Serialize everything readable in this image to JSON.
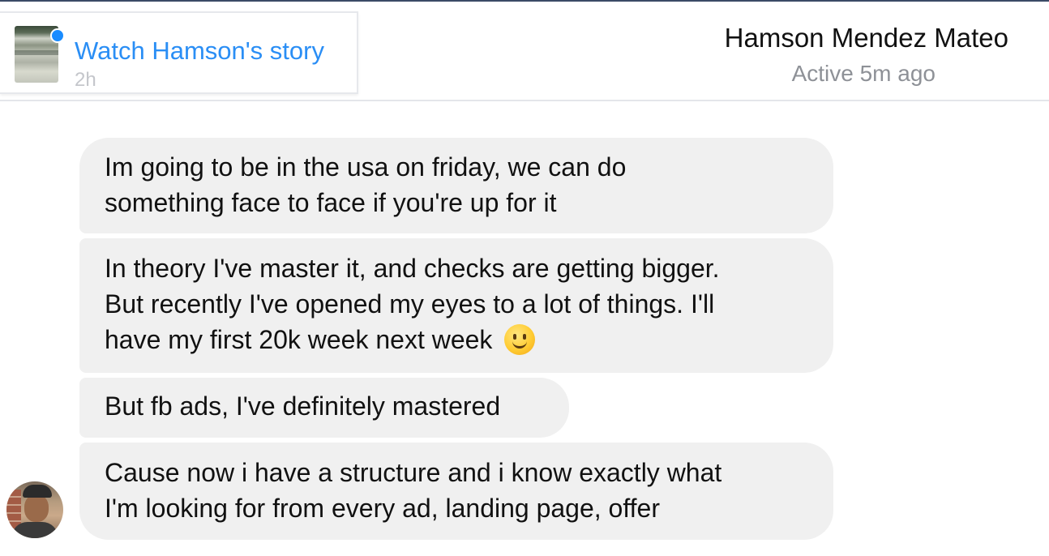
{
  "story": {
    "title": "Watch Hamson's story",
    "time": "2h"
  },
  "contact": {
    "name": "Hamson Mendez Mateo",
    "status": "Active 5m ago"
  },
  "messages": [
    {
      "lines": [
        "Im going to be in the usa on friday, we can do",
        "something face to face if you're up for it"
      ]
    },
    {
      "lines": [
        "In theory I've master it, and checks are getting bigger.",
        "But recently I've opened my eyes to a lot of things. I'll",
        "have my first 20k week next week"
      ],
      "emoji": "smiling-face"
    },
    {
      "lines": [
        "But fb ads, I've definitely mastered"
      ]
    },
    {
      "lines": [
        "Cause now i have a structure and i know exactly what",
        "I'm looking for from every ad, landing page, offer"
      ]
    }
  ],
  "colors": {
    "link_blue": "#2a8ef5",
    "unread_dot": "#1a8cff",
    "bubble_bg": "#f0f0f0",
    "status_gray": "#8e9197"
  }
}
